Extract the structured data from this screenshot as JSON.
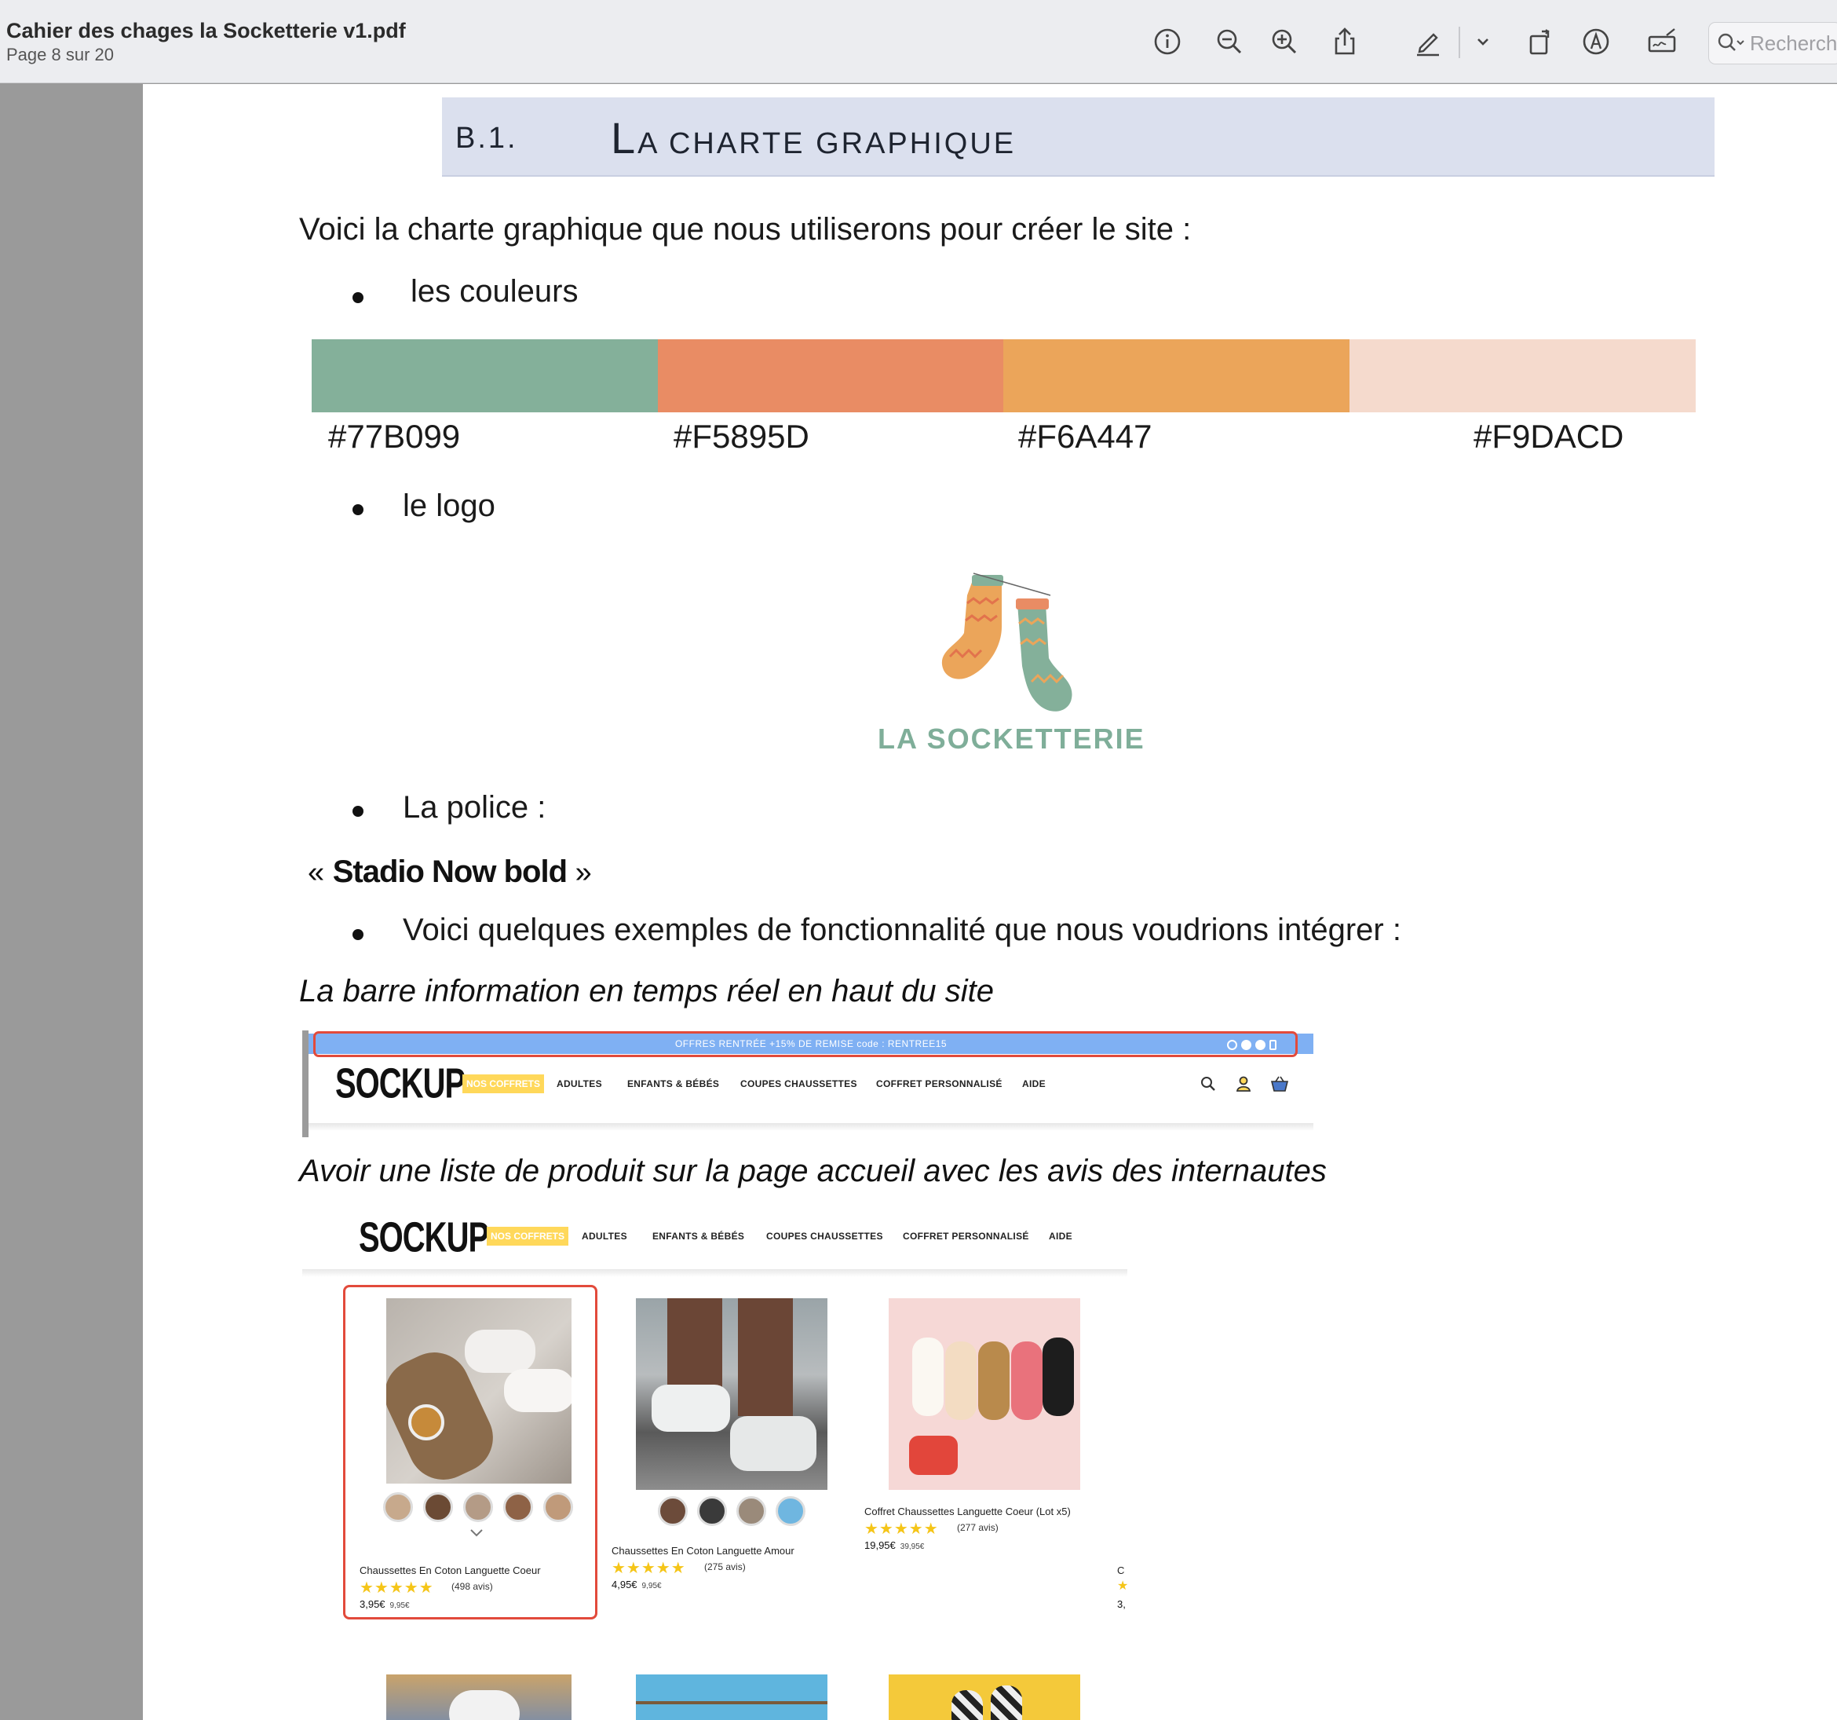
{
  "window": {
    "title": "Cahier des chages la Socketterie v1.pdf",
    "page_indicator": "Page 8 sur 20",
    "search_placeholder": "Recherche"
  },
  "toolbar": {
    "icons": [
      "info-icon",
      "zoom-out-icon",
      "zoom-in-icon",
      "share-icon",
      "highlight-pen-icon",
      "chevron-down-icon",
      "rotate-icon",
      "markup-icon",
      "signature-icon",
      "search-icon"
    ]
  },
  "section": {
    "number": "B.1.",
    "title_cap": "L",
    "title_rest": "A CHARTE GRAPHIQUE"
  },
  "content": {
    "intro": "Voici la charte graphique que nous utiliserons pour créer le site :",
    "bullet_colors": "les couleurs",
    "bullet_logo": "le logo",
    "bullet_font": "La police :",
    "font_sample_open": "« ",
    "font_sample_name": "Stadio Now bold",
    "font_sample_close": " »",
    "bullet_features": "Voici quelques exemples de fonctionnalité que nous voudrions intégrer :",
    "caption_infobar": "La barre information en temps réel en haut du site",
    "caption_products": "Avoir une liste de produit sur la page accueil avec les avis des internautes"
  },
  "palette": [
    {
      "hex": "#77B099",
      "label": "#77B099",
      "display": "#84b09a"
    },
    {
      "hex": "#F5895D",
      "label": "#F5895D",
      "display": "#e98c64"
    },
    {
      "hex": "#F6A447",
      "label": "#F6A447",
      "display": "#eba55a"
    },
    {
      "hex": "#F9DACD",
      "label": "#F9DACD",
      "display": "#f5dacd"
    }
  ],
  "logo": {
    "text": "LA SOCKETTERIE",
    "color_green": "#77B099",
    "color_orange": "#F6A447"
  },
  "shot_header": {
    "infobar_text": "OFFRES RENTRÉE +15% DE REMISE code : RENTREE15",
    "brand": "SOCKUP",
    "nav": [
      "NOS COFFRETS",
      "ADULTES",
      "ENFANTS & BÉBÉS",
      "COUPES CHAUSSETTES",
      "COFFRET PERSONNALISÉ",
      "AIDE"
    ]
  },
  "shot_products": {
    "brand": "SOCKUP",
    "nav": [
      "NOS COFFRETS",
      "ADULTES",
      "ENFANTS & BÉBÉS",
      "COUPES CHAUSSETTES",
      "COFFRET PERSONNALISÉ",
      "AIDE"
    ],
    "products": [
      {
        "title": "Chaussettes En Coton Languette Coeur",
        "stars": "★★★★★",
        "reviews": "(498 avis)",
        "price": "3,95€",
        "old_price": "9,95€"
      },
      {
        "title": "Chaussettes En Coton Languette Amour",
        "stars": "★★★★★",
        "reviews": "(275 avis)",
        "price": "4,95€",
        "old_price": "9,95€"
      },
      {
        "title": "Coffret Chaussettes Languette Coeur (Lot x5)",
        "stars": "★★★★★",
        "reviews": "(277 avis)",
        "price": "19,95€",
        "old_price": "39,95€"
      }
    ],
    "partial_next": {
      "title": "C",
      "stars": "★",
      "price": "3,"
    }
  }
}
